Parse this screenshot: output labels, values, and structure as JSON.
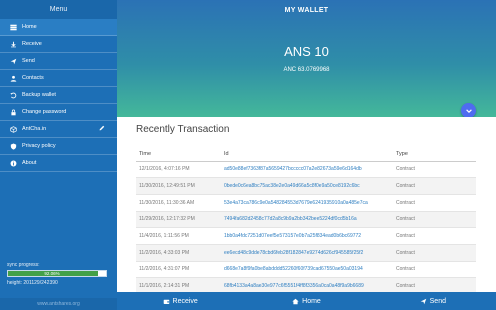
{
  "sidebar": {
    "title": "Menu",
    "items": [
      {
        "label": "Home"
      },
      {
        "label": "Receive"
      },
      {
        "label": "Send"
      },
      {
        "label": "Contacts"
      },
      {
        "label": "Backup wallet"
      },
      {
        "label": "Change password"
      },
      {
        "label": "AntCha.in"
      },
      {
        "label": "Privacy policy"
      },
      {
        "label": "About"
      }
    ],
    "sync_label": "sync progress:",
    "sync_percent_text": "92.06%",
    "sync_fraction": 0.9206,
    "height_label": "height: 201129/242390",
    "footer": "www.antshares.org"
  },
  "header": {
    "title": "MY WALLET",
    "ans_balance": "ANS 10",
    "anc_balance": "ANC 63.0769968"
  },
  "transactions": {
    "title": "Recently Transaction",
    "columns": {
      "time": "Time",
      "id": "Id",
      "type": "Type"
    },
    "rows": [
      {
        "time": "12/1/2016, 4:07:16 PM",
        "id": "ad50e88ef7363f87a5659427bccccc07a2e82673a59e6d164db",
        "type": "Contract"
      },
      {
        "time": "11/30/2016, 12:49:51 PM",
        "id": "0bede0c6ea8bc75ac38e2e0a49d66a5c8f0e9a50ce8192c6bc",
        "type": "Contract"
      },
      {
        "time": "11/30/2016, 11:30:36 AM",
        "id": "53e4a73ca786c9e0a548284553d7679e6241935910a0a485e7ca",
        "type": "Contract"
      },
      {
        "time": "11/29/2016, 12:17:32 PM",
        "id": "7494fa682d2458c77d2a8c9b9a2bb342bee5224df0cd5b16a",
        "type": "Contract"
      },
      {
        "time": "11/4/2016, 1:11:56 PM",
        "id": "1bb0a4fdc7251d07eef5e573157e0b7a25f834ead0b6bc69772",
        "type": "Contract"
      },
      {
        "time": "11/2/2016, 4:33:03 PM",
        "id": "ee6ecd48c9dde78cbd6feb28f182847e9274d626cf945585f25f2",
        "type": "Contract"
      },
      {
        "time": "11/2/2016, 4:31:07 PM",
        "id": "d668e7a8f9fa0be8abdddd52260f60f739cad67550ae50a03194",
        "type": "Contract"
      },
      {
        "time": "11/1/2016, 2:14:31 PM",
        "id": "68fb4133a4a8ae30e977c6f5551f4ff8f3356a0ca0a48f9a9b6689",
        "type": "Contract"
      }
    ]
  },
  "bottom_bar": {
    "receive": "Receive",
    "home": "Home",
    "send": "Send"
  },
  "colors": {
    "sidebar": "#1d6fb6",
    "header_top": "#2b72b5",
    "header_bottom": "#44b89a",
    "fab": "#4f6cf0",
    "sync_fill": "#43a047",
    "link": "#2f7fc1"
  }
}
